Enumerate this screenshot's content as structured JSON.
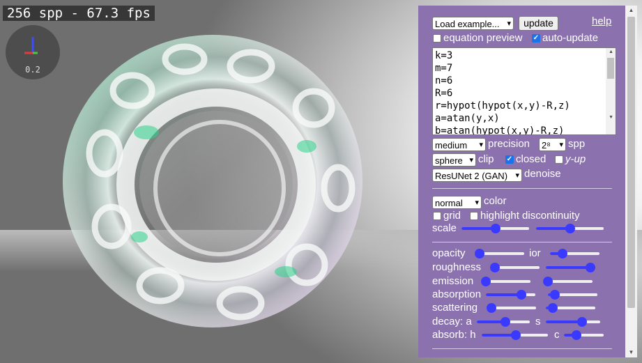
{
  "viewport": {
    "stats": "256 spp - 67.3 fps",
    "axes_scale": "0.2"
  },
  "panel": {
    "example_select": "Load example...",
    "update_button": "update",
    "help_link": "help",
    "equation_preview": {
      "label": "equation preview",
      "checked": false
    },
    "auto_update": {
      "label": "auto-update",
      "checked": true
    },
    "equation_lines": [
      "k=3",
      "m=7",
      "n=6",
      "R=6",
      "r=hypot(hypot(x,y)-R,z)",
      "a=atan(y,x)",
      "b=atan(hypot(x,y)-R,z)"
    ],
    "precision_select": "medium",
    "precision_label": "precision",
    "spp_select": "2⁸",
    "spp_label": "spp",
    "clip_select": "sphere",
    "clip_label": "clip",
    "closed": {
      "label": "closed",
      "checked": true
    },
    "y_up": {
      "label": "y-up",
      "checked": false
    },
    "denoise_select": "ResUNet 2 (GAN)",
    "denoise_label": "denoise",
    "color_select": "normal",
    "color_label": "color",
    "grid": {
      "label": "grid",
      "checked": false
    },
    "highlight": {
      "label": "highlight discontinuity",
      "checked": false
    },
    "scale_label": "scale",
    "sliders": {
      "scale_a": 0.5,
      "scale_b": 0.5,
      "opacity": 0.0,
      "ior": 0.2,
      "roughness": 0.0,
      "roughness_b": 1.0,
      "emission": 0.0,
      "emission_b": 0.0,
      "absorption": 0.78,
      "absorption_b": 0.05,
      "scattering": 0.0,
      "scattering_b": 0.05,
      "decay_a": 0.55,
      "decay_s": 0.7,
      "absorb_h": 0.52,
      "absorb_c": 0.25
    },
    "labels": {
      "opacity": "opacity",
      "ior": "ior",
      "roughness": "roughness",
      "emission": "emission",
      "absorption": "absorption",
      "scattering": "scattering",
      "decay_a": "decay: a",
      "decay_s": "s",
      "absorb_h": "absorb: h",
      "absorb_c": "c"
    }
  }
}
